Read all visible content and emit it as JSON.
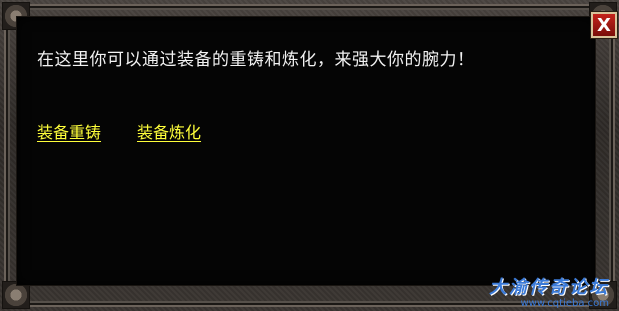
{
  "dialog": {
    "message": "在这里你可以通过装备的重铸和炼化，来强大你的腕力！",
    "links": [
      {
        "label": "装备重铸"
      },
      {
        "label": "装备炼化"
      }
    ],
    "close_icon": "close-icon",
    "close_label": "X"
  },
  "watermark": {
    "title": "大渝传奇论坛",
    "url": "www.cqtieba.com"
  },
  "colors": {
    "link": "#ffff3a",
    "text": "#f2f2f2",
    "close_bg": "#c4231b",
    "watermark": "#3a7ad8"
  }
}
